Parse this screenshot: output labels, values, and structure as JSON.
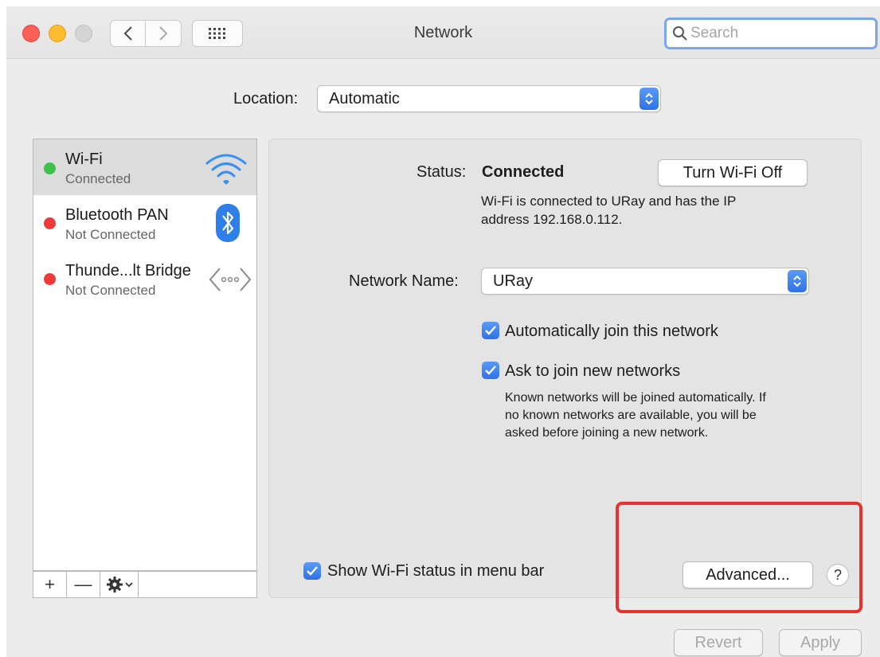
{
  "window": {
    "title": "Network"
  },
  "toolbar": {
    "back_icon": "chevron-left-icon",
    "forward_icon": "chevron-right-icon",
    "grid_icon": "grid-icon",
    "search_placeholder": "Search"
  },
  "location": {
    "label": "Location:",
    "value": "Automatic"
  },
  "sidebar": {
    "services": [
      {
        "name": "Wi-Fi",
        "status": "Connected",
        "dot": "#3ec14a",
        "icon": "wifi-icon"
      },
      {
        "name": "Bluetooth PAN",
        "status": "Not Connected",
        "dot": "#ef3a3a",
        "icon": "bluetooth-icon"
      },
      {
        "name": "Thunde...lt Bridge",
        "status": "Not Connected",
        "dot": "#ef3a3a",
        "icon": "ethernet-bridge-icon"
      }
    ],
    "footer": {
      "add": "+",
      "remove": "—"
    }
  },
  "panel": {
    "status_label": "Status:",
    "status_value": "Connected",
    "turn_off_label": "Turn Wi-Fi Off",
    "status_desc_line1": "Wi-Fi is connected to URay and has the IP",
    "status_desc_line2": "address 192.168.0.112.",
    "network_name_label": "Network Name:",
    "network_name_value": "URay",
    "auto_join_label": "Automatically join this network",
    "auto_join_checked": true,
    "ask_join_label": "Ask to join new networks",
    "ask_join_checked": true,
    "ask_note_line1": "Known networks will be joined automatically. If",
    "ask_note_line2": "no known networks are available, you will be",
    "ask_note_line3": "asked before joining a new network.",
    "show_status_label": "Show Wi-Fi status in menu bar",
    "show_status_checked": true,
    "advanced_label": "Advanced...",
    "help_label": "?"
  },
  "footer": {
    "revert_label": "Revert",
    "apply_label": "Apply"
  },
  "colors": {
    "accent": "#3b82f6",
    "highlight": "#e8322e"
  }
}
